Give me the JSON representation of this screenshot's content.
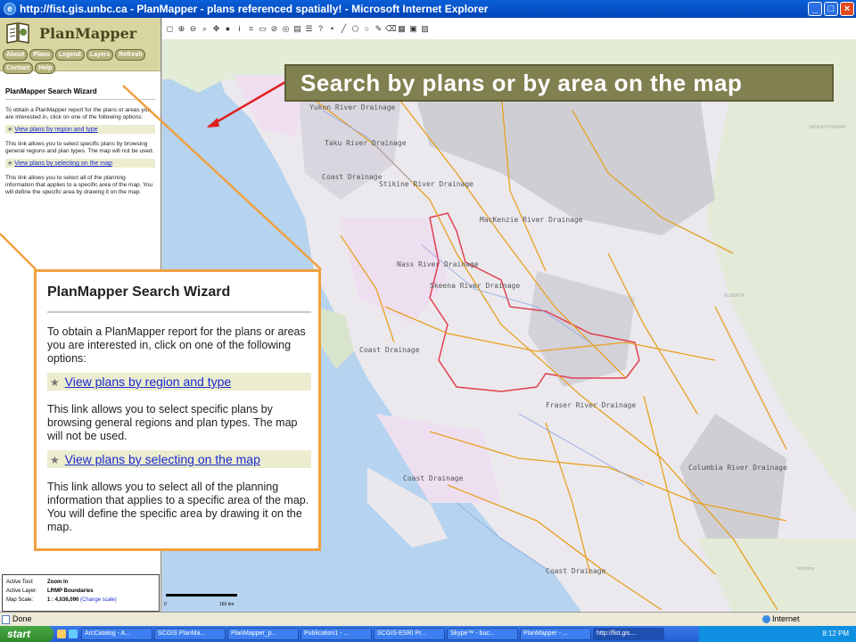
{
  "window": {
    "title": "http://fist.gis.unbc.ca - PlanMapper - plans referenced spatially! - Microsoft Internet Explorer",
    "min": "_",
    "max": "□",
    "close": "×"
  },
  "app": {
    "name": "PlanMapper"
  },
  "nav": {
    "items": [
      "About",
      "Plans",
      "Legend",
      "Layers",
      "Refresh",
      "Contact",
      "Help"
    ]
  },
  "wizard": {
    "title": "PlanMapper Search Wizard",
    "intro": "To obtain a PlanMapper report for the plans or areas you are interested in, click on one of the following options:",
    "link1": "View plans by region and type",
    "desc1": "This link allows you to select specific plans by browsing general regions and plan types. The map will not be used.",
    "link2": "View plans by selecting on the map",
    "desc2": "This link allows you to select all of the planning information that applies to a specific area of the map. You will define the specific area by drawing it on the map."
  },
  "status_panel": {
    "tool_label": "Active Tool:",
    "tool_value": "Zoom In",
    "layer_label": "Active Layer:",
    "layer_value": "LRMP Boundaries",
    "scale_label": "Map Scale:",
    "scale_value": "1 : 4,036,090",
    "scale_link": "(Change scale)"
  },
  "toolbar": {
    "icons": [
      "select-icon",
      "zoom-in-icon",
      "zoom-out-icon",
      "zoom-box-icon",
      "pan-icon",
      "info-icon",
      "identify-icon",
      "measure-icon",
      "print-icon",
      "clear-icon",
      "buffer-icon",
      "layer-icon",
      "legend-icon",
      "query-icon",
      "point-icon",
      "line-icon",
      "polygon-icon",
      "circle-icon",
      "draw-icon",
      "erase-icon",
      "grid-icon",
      "save-icon",
      "export-icon"
    ]
  },
  "map": {
    "labels": [
      "Yukon River Drainage",
      "Taku River Drainage",
      "Coast Drainage",
      "Stikine River Drainage",
      "MacKenzie River Drainage",
      "Nass River Drainage",
      "Skeena River Drainage",
      "Coast Drainage",
      "Fraser River Drainage",
      "Columbia River Drainage",
      "Coast Drainage",
      "Coast Drainage"
    ],
    "regions": [
      "SASKATCHEWAN",
      "ALBERTA",
      "Montana"
    ],
    "scalebar_start": "0",
    "scalebar_end": "160 km"
  },
  "callout": {
    "text": "Search by plans or by area on the map"
  },
  "statusbar": {
    "text": "Done",
    "zone": "Internet"
  },
  "taskbar": {
    "start": "start",
    "tasks": [
      "ArcCatalog - A...",
      "SCGIS PlanMa...",
      "PlanMapper_p...",
      "Publication1 - ...",
      "SCGIS-ESRI Pr...",
      "Skype™ - buc...",
      "PlanMapper - ...",
      "http://fist.gis...."
    ],
    "clock": "8:12 PM"
  },
  "colors": {
    "accent": "#f0a040",
    "banner": "#808050",
    "link": "#1a2ad0",
    "boundary": "#e04050",
    "rivers": "#e8a020"
  }
}
